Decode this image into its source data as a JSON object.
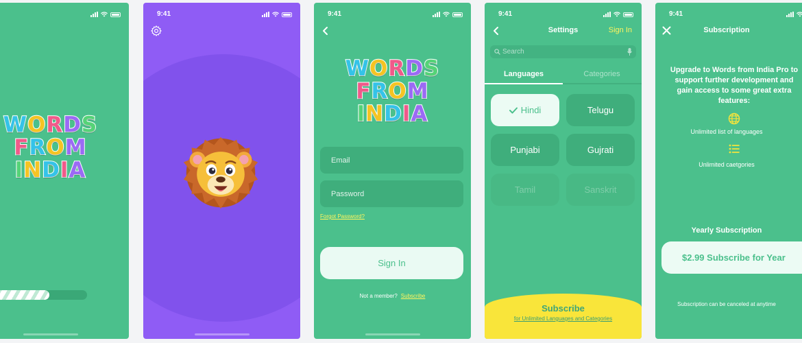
{
  "status": {
    "time": "9:41"
  },
  "logo": {
    "line1": "WORDS",
    "line2": "FROM",
    "line3": "INDIA"
  },
  "splash": {
    "progress": 0.67
  },
  "login": {
    "email_placeholder": "Email",
    "password_placeholder": "Password",
    "forgot": "Forgot Password?",
    "sign_in": "Sign In",
    "not_member": "Not a member?",
    "subscribe": "Subscribe"
  },
  "settings": {
    "title": "Settings",
    "sign_in": "Sign In",
    "search_placeholder": "Search",
    "tabs": [
      "Languages",
      "Categories"
    ],
    "languages": [
      {
        "label": "Hindi",
        "state": "selected"
      },
      {
        "label": "Telugu",
        "state": "normal"
      },
      {
        "label": "Punjabi",
        "state": "normal"
      },
      {
        "label": "Gujrati",
        "state": "normal"
      },
      {
        "label": "Tamil",
        "state": "locked"
      },
      {
        "label": "Sanskrit",
        "state": "locked"
      }
    ],
    "subscribe_title": "Subscribe",
    "subscribe_sub": "for Unlimited Languages and Categories"
  },
  "subscription": {
    "title": "Subscription",
    "description": "Upgrade to Words from India Pro to support further development and gain access to some great extra features:",
    "features": [
      {
        "icon": "globe-icon",
        "label": "Unlimited list of languages"
      },
      {
        "icon": "list-icon",
        "label": "Unlimited caetgories"
      }
    ],
    "plan_label": "Yearly Subscription",
    "button": "$2.99 Subscribe for Year",
    "cancel_note": "Subscription can be canceled at anytime"
  },
  "colors": {
    "green": "#4bc08c",
    "purple": "#8f5cf5",
    "yellow": "#f9e53a",
    "link": "#fff45e"
  }
}
